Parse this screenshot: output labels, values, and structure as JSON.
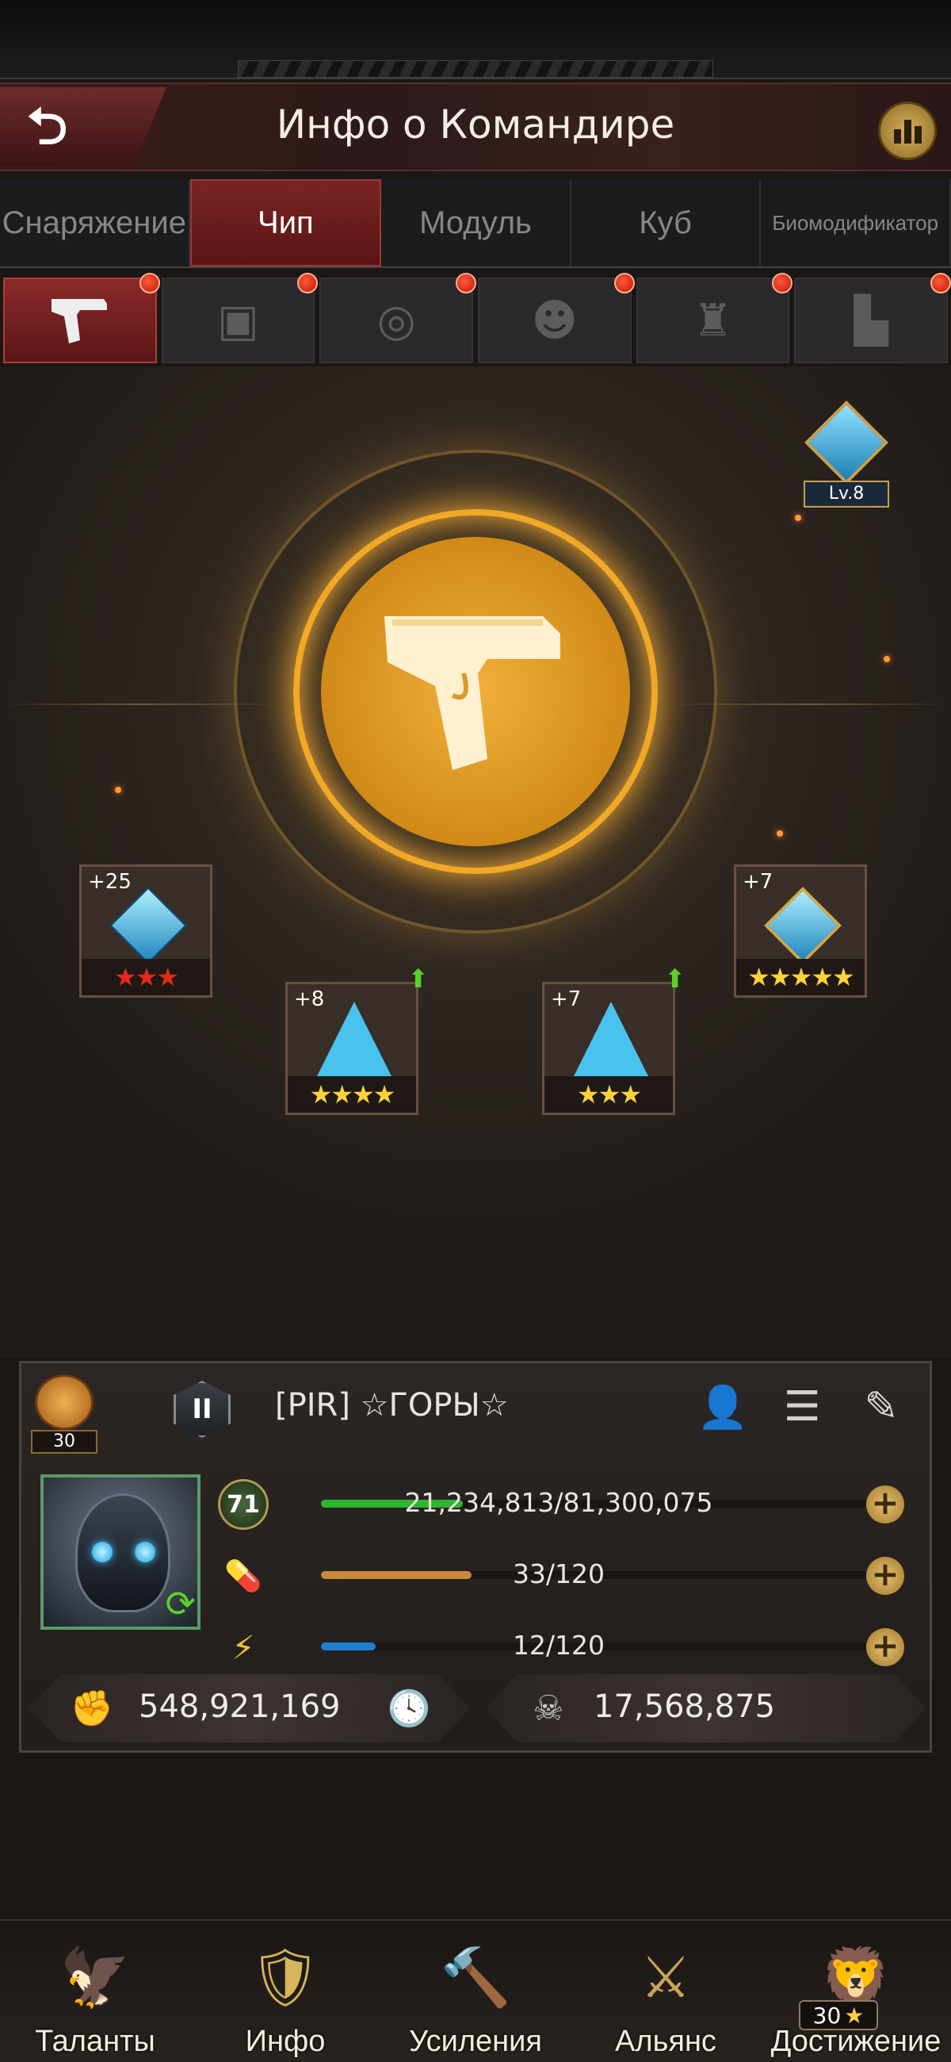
{
  "header": {
    "title": "Инфо о Командире"
  },
  "tabs": [
    {
      "label": "Снаряжение",
      "active": false
    },
    {
      "label": "Чип",
      "active": true
    },
    {
      "label": "Модуль",
      "active": false
    },
    {
      "label": "Куб",
      "active": false
    },
    {
      "label": "Биомодификатор",
      "active": false
    }
  ],
  "slots": [
    {
      "icon": "pistol-icon",
      "active": true
    },
    {
      "icon": "armor-plate-icon",
      "active": false
    },
    {
      "icon": "ring-icon",
      "active": false
    },
    {
      "icon": "gas-mask-icon",
      "active": false
    },
    {
      "icon": "jacket-icon",
      "active": false
    },
    {
      "icon": "boot-icon",
      "active": false
    }
  ],
  "chip": {
    "level": "Lv.8"
  },
  "modules": [
    {
      "bonus": "+25",
      "stars": "★★★",
      "star_color": "red"
    },
    {
      "bonus": "+8",
      "stars": "★★★★",
      "upgrade": true
    },
    {
      "bonus": "+7",
      "stars": "★★★",
      "upgrade": true
    },
    {
      "bonus": "+7",
      "stars": "★★★★★"
    }
  ],
  "commander": {
    "rank_count": "30",
    "alliance_rank": "II",
    "name": "[PIR]  ☆ГОРЫ☆",
    "level": "71",
    "exp": {
      "text": "21,234,813/81,300,075",
      "fraction": 0.26
    },
    "stamina": {
      "text": "33/120",
      "fraction": 0.275
    },
    "energy": {
      "text": "12/120",
      "fraction": 0.1
    },
    "power": "548,921,169",
    "kills": "17,568,875"
  },
  "colors": {
    "exp": "#2fb52f",
    "stamina": "#c98a3a",
    "energy": "#1f7fd0"
  },
  "nav": [
    {
      "label": "Таланты",
      "icon": "eagle-wings-icon"
    },
    {
      "label": "Инфо",
      "icon": "commander-shield-icon"
    },
    {
      "label": "Усиления",
      "icon": "hammer-icon"
    },
    {
      "label": "Альянс",
      "icon": "crossed-swords-icon"
    },
    {
      "label": "Достижение",
      "icon": "lion-crest-icon",
      "badge": "30"
    }
  ]
}
